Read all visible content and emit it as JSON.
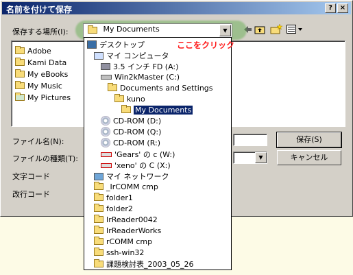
{
  "dialog": {
    "title": "名前を付けて保存",
    "help_label": "?",
    "close_label": "×",
    "save_in_label": "保存する場所(I):",
    "save_in_value": "My Documents",
    "hint": "ここをクリック",
    "filename_label": "ファイル名(N):",
    "filetype_label": "ファイルの種類(T):",
    "encoding_label": "文字コード",
    "newline_label": "改行コード",
    "save_button": "保存(S)",
    "cancel_button": "キャンセル"
  },
  "files": [
    {
      "label": "Adobe",
      "icon": "folder-icon"
    },
    {
      "label": "Kami Data",
      "icon": "folder-icon"
    },
    {
      "label": "My eBooks",
      "icon": "folder-icon"
    },
    {
      "label": "My Music",
      "icon": "folder-icon"
    },
    {
      "label": "My Pictures",
      "icon": "pictures-folder-icon"
    }
  ],
  "dropdown": [
    {
      "label": "デスクトップ",
      "icon": "desktop-icon",
      "indent": 0
    },
    {
      "label": "マイ コンピュータ",
      "icon": "computer-icon",
      "indent": 1
    },
    {
      "label": "3.5 インチ FD (A:)",
      "icon": "floppy-icon",
      "indent": 2
    },
    {
      "label": "Win2kMaster (C:)",
      "icon": "drive-icon",
      "indent": 2
    },
    {
      "label": "Documents and Settings",
      "icon": "folder-icon",
      "indent": 3
    },
    {
      "label": "kuno",
      "icon": "folder-icon",
      "indent": 4
    },
    {
      "label": "My Documents",
      "icon": "folder-open-icon",
      "indent": 5,
      "selected": true
    },
    {
      "label": "CD-ROM (D:)",
      "icon": "cdrom-icon",
      "indent": 2
    },
    {
      "label": "CD-ROM (Q:)",
      "icon": "cdrom-icon",
      "indent": 2
    },
    {
      "label": "CD-ROM (R:)",
      "icon": "cdrom-icon",
      "indent": 2
    },
    {
      "label": "'Gears' の c (W:)",
      "icon": "network-drive-disconnected-icon",
      "indent": 2
    },
    {
      "label": "'xeno' の C (X:)",
      "icon": "network-drive-disconnected-icon",
      "indent": 2
    },
    {
      "label": "マイ ネットワーク",
      "icon": "network-icon",
      "indent": 1
    },
    {
      "label": "_IrCOMM cmp",
      "icon": "folder-icon",
      "indent": 1
    },
    {
      "label": "folder1",
      "icon": "folder-icon",
      "indent": 1
    },
    {
      "label": "folder2",
      "icon": "folder-icon",
      "indent": 1
    },
    {
      "label": "IrReader0042",
      "icon": "folder-icon",
      "indent": 1
    },
    {
      "label": "IrReaderWorks",
      "icon": "folder-icon",
      "indent": 1
    },
    {
      "label": "rCOMM cmp",
      "icon": "folder-icon",
      "indent": 1
    },
    {
      "label": "ssh-win32",
      "icon": "folder-icon",
      "indent": 1
    },
    {
      "label": "課題検討表_2003_05_26",
      "icon": "folder-icon",
      "indent": 1
    }
  ]
}
